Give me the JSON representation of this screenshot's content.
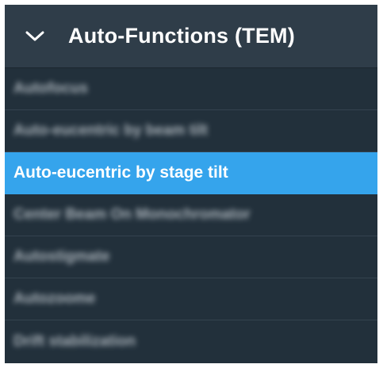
{
  "section": {
    "title": "Auto-Functions (TEM)",
    "expanded": true,
    "toggle_icon": "chevron-down-icon"
  },
  "items": [
    {
      "label": "Autofocus",
      "selected": false,
      "obscured": true
    },
    {
      "label": "Auto-eucentric by beam tilt",
      "selected": false,
      "obscured": true
    },
    {
      "label": "Auto-eucentric by stage tilt",
      "selected": true,
      "obscured": false
    },
    {
      "label": "Center Beam On Monochromator",
      "selected": false,
      "obscured": true
    },
    {
      "label": "Autostigmate",
      "selected": false,
      "obscured": true
    },
    {
      "label": "Autozoome",
      "selected": false,
      "obscured": true
    },
    {
      "label": "Drift stabilization",
      "selected": false,
      "obscured": true
    }
  ],
  "colors": {
    "panel_bg": "#22303b",
    "header_bg": "#2f3d49",
    "selected_bg": "#35a4ec",
    "divider": "#34434f",
    "text": "#ffffff"
  }
}
